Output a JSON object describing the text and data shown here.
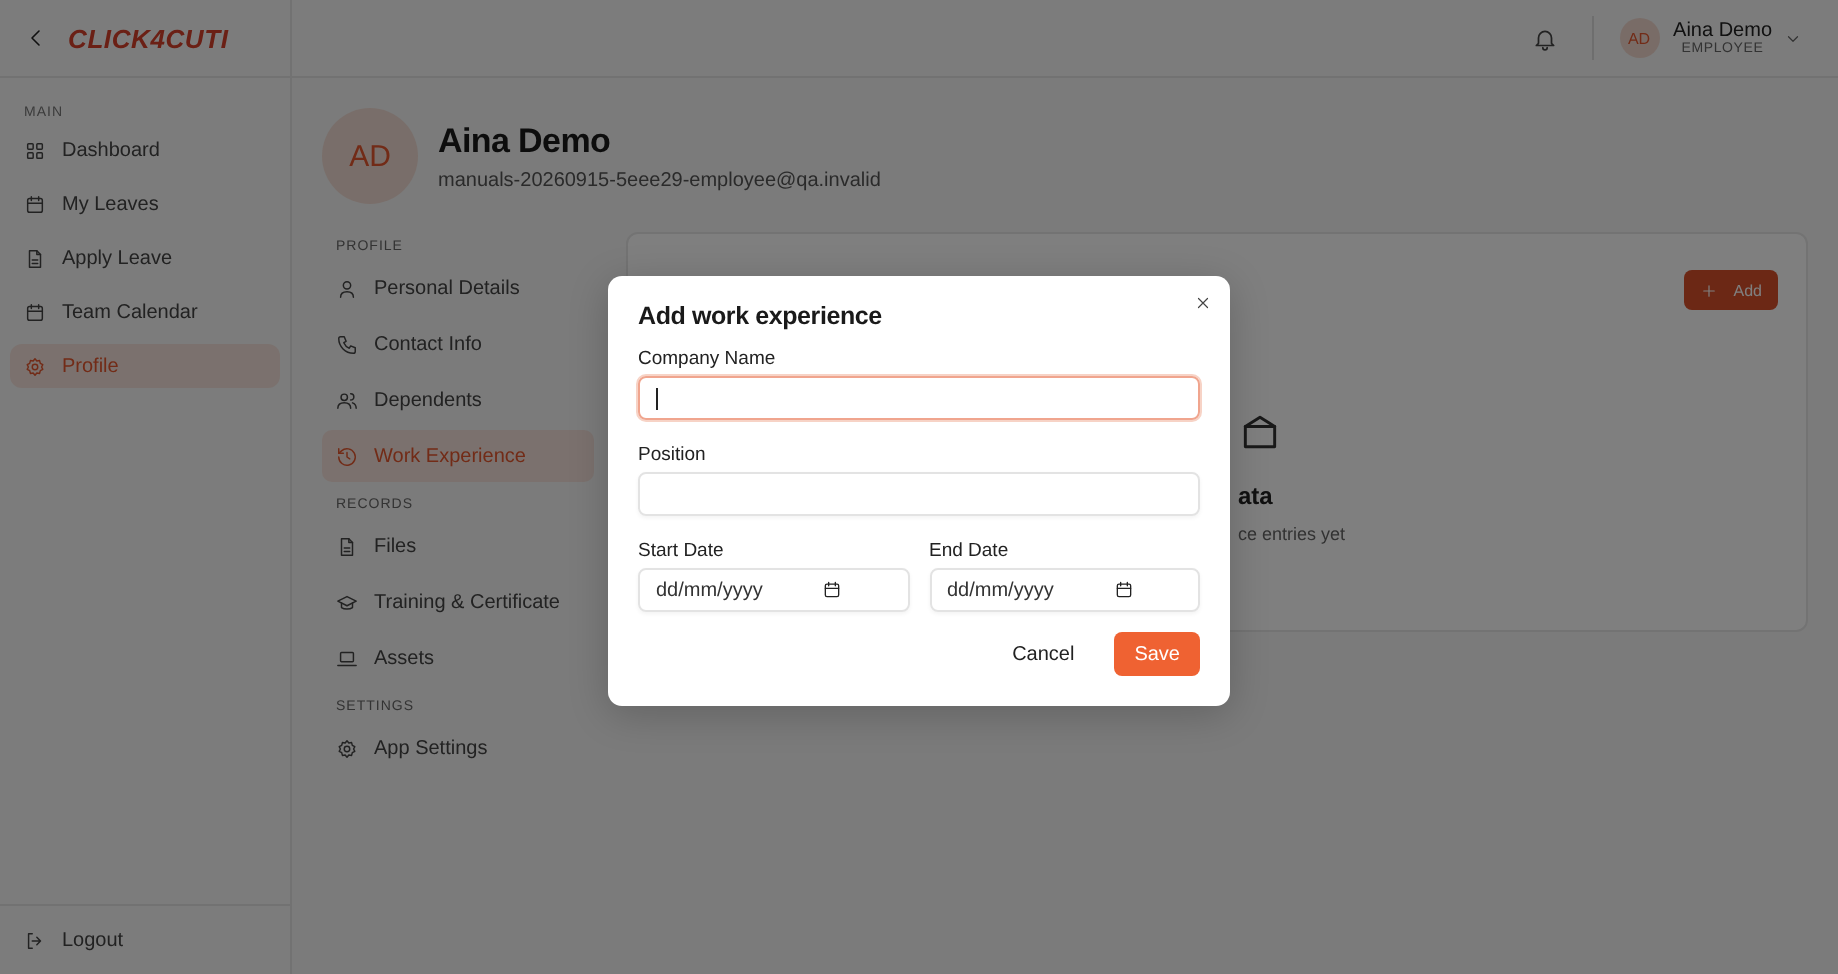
{
  "app": {
    "logo": "CLICK4CUTI"
  },
  "sidebar": {
    "sections": [
      {
        "label": "MAIN",
        "items": [
          {
            "label": "Dashboard",
            "selected": false
          },
          {
            "label": "My Leaves",
            "selected": false
          },
          {
            "label": "Apply Leave",
            "selected": false
          },
          {
            "label": "Team Calendar",
            "selected": false
          },
          {
            "label": "Profile",
            "selected": true
          }
        ]
      }
    ],
    "footer": {
      "label": "Logout"
    }
  },
  "topbar": {
    "user": {
      "initials": "AD",
      "name": "Aina Demo",
      "role": "EMPLOYEE"
    }
  },
  "profile": {
    "initials": "AD",
    "name": "Aina Demo",
    "email": "manuals-20260915-5eee29-employee@qa.invalid",
    "menu": [
      {
        "label": "PROFILE",
        "items": [
          {
            "label": "Personal Details",
            "selected": false
          },
          {
            "label": "Contact Info",
            "selected": false
          },
          {
            "label": "Dependents",
            "selected": false
          },
          {
            "label": "Work Experience",
            "selected": true
          }
        ]
      },
      {
        "label": "RECORDS",
        "items": [
          {
            "label": "Files",
            "selected": false
          },
          {
            "label": "Training & Certificate",
            "selected": false
          },
          {
            "label": "Assets",
            "selected": false
          }
        ]
      },
      {
        "label": "SETTINGS",
        "items": [
          {
            "label": "App Settings",
            "selected": false
          }
        ]
      }
    ]
  },
  "card": {
    "add_button": "Add",
    "empty_title": "ata",
    "empty_text": "ce entries yet"
  },
  "modal": {
    "title": "Add work experience",
    "fields": [
      {
        "kind": "text",
        "label": "Company Name",
        "focused": true
      },
      {
        "kind": "text",
        "label": "Position",
        "focused": false
      },
      {
        "kind": "date",
        "label": "Start Date",
        "placeholder": "dd/mm/yyyy"
      },
      {
        "kind": "date",
        "label": "End Date",
        "placeholder": "dd/mm/yyyy"
      }
    ],
    "buttons": [
      {
        "kind": "secondary",
        "label": "Cancel"
      },
      {
        "kind": "primary",
        "label": "Save"
      }
    ]
  }
}
